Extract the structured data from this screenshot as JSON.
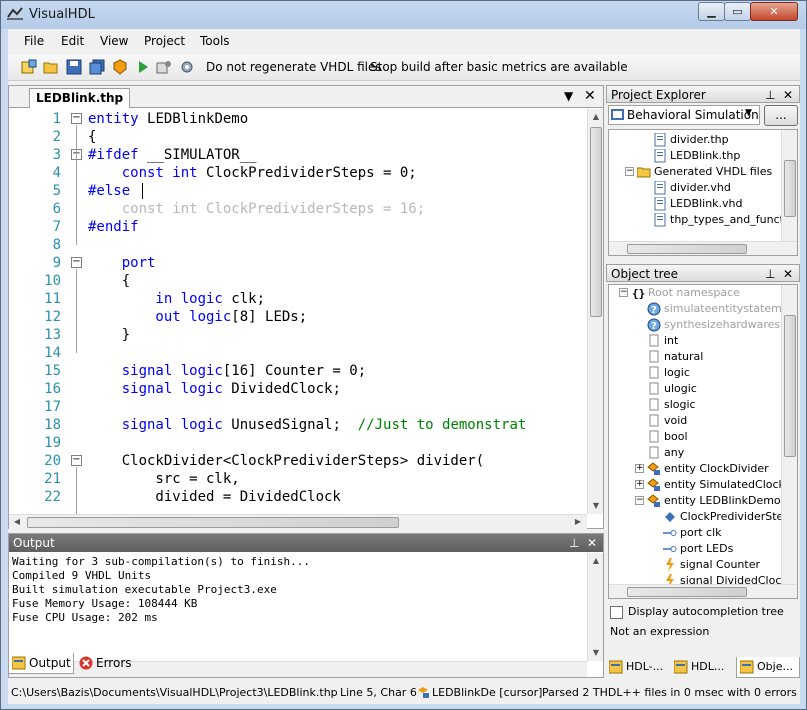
{
  "window": {
    "title": "VisualHDL"
  },
  "menu": [
    "File",
    "Edit",
    "View",
    "Project",
    "Tools"
  ],
  "toolbar": {
    "option1": "Do not regenerate VHDL files",
    "option2": "Stop build after basic metrics are available"
  },
  "editor": {
    "tab_label": "LEDBlink.thp",
    "lines": [
      {
        "n": "1",
        "fold": "−",
        "parts": [
          {
            "t": "entity ",
            "c": "kw"
          },
          {
            "t": "LEDBlinkDemo",
            "c": ""
          }
        ]
      },
      {
        "n": "2",
        "fold": "",
        "parts": [
          {
            "t": "{",
            "c": ""
          }
        ]
      },
      {
        "n": "3",
        "fold": "−",
        "parts": [
          {
            "t": "#ifdef ",
            "c": "kw"
          },
          {
            "t": "__SIMULATOR__",
            "c": ""
          }
        ]
      },
      {
        "n": "4",
        "fold": "",
        "parts": [
          {
            "t": "    const int ",
            "c": "kw"
          },
          {
            "t": "ClockPredividerSteps = 0;",
            "c": ""
          }
        ]
      },
      {
        "n": "5",
        "fold": "",
        "parts": [
          {
            "t": "#else",
            "c": "kw"
          }
        ]
      },
      {
        "n": "6",
        "fold": "",
        "parts": [
          {
            "t": "    const int ClockPredividerSteps = 16;",
            "c": "gr"
          }
        ]
      },
      {
        "n": "7",
        "fold": "",
        "parts": [
          {
            "t": "#endif",
            "c": "kw"
          }
        ]
      },
      {
        "n": "8",
        "fold": "",
        "parts": []
      },
      {
        "n": "9",
        "fold": "−",
        "parts": [
          {
            "t": "    port",
            "c": "kw"
          }
        ]
      },
      {
        "n": "10",
        "fold": "",
        "parts": [
          {
            "t": "    {",
            "c": ""
          }
        ]
      },
      {
        "n": "11",
        "fold": "",
        "parts": [
          {
            "t": "        in logic ",
            "c": "kw"
          },
          {
            "t": "clk;",
            "c": ""
          }
        ]
      },
      {
        "n": "12",
        "fold": "",
        "parts": [
          {
            "t": "        out logic",
            "c": "kw"
          },
          {
            "t": "[8] LEDs;",
            "c": ""
          }
        ]
      },
      {
        "n": "13",
        "fold": "",
        "parts": [
          {
            "t": "    }",
            "c": ""
          }
        ]
      },
      {
        "n": "14",
        "fold": "",
        "parts": []
      },
      {
        "n": "15",
        "fold": "",
        "parts": [
          {
            "t": "    signal logic",
            "c": "kw"
          },
          {
            "t": "[16] Counter = 0;",
            "c": ""
          }
        ]
      },
      {
        "n": "16",
        "fold": "",
        "parts": [
          {
            "t": "    signal logic ",
            "c": "kw"
          },
          {
            "t": "DividedClock;",
            "c": ""
          }
        ]
      },
      {
        "n": "17",
        "fold": "",
        "parts": []
      },
      {
        "n": "18",
        "fold": "",
        "parts": [
          {
            "t": "    signal logic ",
            "c": "kw"
          },
          {
            "t": "UnusedSignal;  ",
            "c": ""
          },
          {
            "t": "//Just to demonstrat",
            "c": "cm"
          }
        ]
      },
      {
        "n": "19",
        "fold": "",
        "parts": []
      },
      {
        "n": "20",
        "fold": "−",
        "parts": [
          {
            "t": "    ClockDivider<ClockPredividerSteps> divider(",
            "c": ""
          }
        ]
      },
      {
        "n": "21",
        "fold": "",
        "parts": [
          {
            "t": "        src = clk,",
            "c": ""
          }
        ]
      },
      {
        "n": "22",
        "fold": "",
        "parts": [
          {
            "t": "        divided = DividedClock",
            "c": ""
          }
        ]
      }
    ]
  },
  "output": {
    "title": "Output",
    "lines": [
      "Waiting for 3 sub-compilation(s) to finish...",
      "Compiled 9 VHDL Units",
      "Built simulation executable Project3.exe",
      "Fuse Memory Usage: 108444 KB",
      "Fuse CPU Usage: 202 ms"
    ]
  },
  "bottom_tabs": [
    "Output",
    "Errors"
  ],
  "project_explorer": {
    "title": "Project Explorer",
    "config": "Behavioral Simulation",
    "browse_label": "...",
    "items": [
      {
        "label": "divider.thp",
        "level": 2,
        "icon": "file"
      },
      {
        "label": "LEDBlink.thp",
        "level": 2,
        "icon": "file"
      },
      {
        "label": "Generated VHDL files",
        "level": 1,
        "icon": "folder"
      },
      {
        "label": "divider.vhd",
        "level": 2,
        "icon": "file"
      },
      {
        "label": "LEDBlink.vhd",
        "level": 2,
        "icon": "file"
      },
      {
        "label": "thp_types_and_function",
        "level": 2,
        "icon": "file"
      }
    ]
  },
  "object_tree": {
    "title": "Object tree",
    "items": [
      {
        "label": "Root namespace",
        "level": 0,
        "icon": "braces",
        "dim": true
      },
      {
        "label": "simulateentitystatement",
        "level": 1,
        "icon": "question",
        "dim": true
      },
      {
        "label": "synthesizehardwarestat",
        "level": 1,
        "icon": "question",
        "dim": true
      },
      {
        "label": "int",
        "level": 1,
        "icon": "type"
      },
      {
        "label": "natural",
        "level": 1,
        "icon": "type"
      },
      {
        "label": "logic",
        "level": 1,
        "icon": "type"
      },
      {
        "label": "ulogic",
        "level": 1,
        "icon": "type"
      },
      {
        "label": "slogic",
        "level": 1,
        "icon": "type"
      },
      {
        "label": "void",
        "level": 1,
        "icon": "type"
      },
      {
        "label": "bool",
        "level": 1,
        "icon": "type"
      },
      {
        "label": "any",
        "level": 1,
        "icon": "type"
      },
      {
        "label": "entity ClockDivider",
        "level": 1,
        "icon": "entity"
      },
      {
        "label": "entity SimulatedClockPr",
        "level": 1,
        "icon": "entity"
      },
      {
        "label": "entity LEDBlinkDemo",
        "level": 1,
        "icon": "entity"
      },
      {
        "label": "ClockPredividerStep",
        "level": 2,
        "icon": "const"
      },
      {
        "label": "port clk",
        "level": 2,
        "icon": "port"
      },
      {
        "label": "port LEDs",
        "level": 2,
        "icon": "port"
      },
      {
        "label": "signal Counter",
        "level": 2,
        "icon": "signal"
      },
      {
        "label": "signal DividedClock",
        "level": 2,
        "icon": "signal"
      }
    ],
    "autocompletion_label": "Display autocompletion tree",
    "expr_status": "Not an expression"
  },
  "right_tabs": [
    "HDL-...",
    "HDL...",
    "Obje..."
  ],
  "statusbar": {
    "path": "C:\\Users\\Bazis\\Documents\\VisualHDL\\Project3\\LEDBlink.thp",
    "position": "Line 5, Char 6",
    "context": "LEDBlinkDe [cursor]",
    "parse": "Parsed 2 THDL++ files in 0 msec with 0 errors"
  }
}
